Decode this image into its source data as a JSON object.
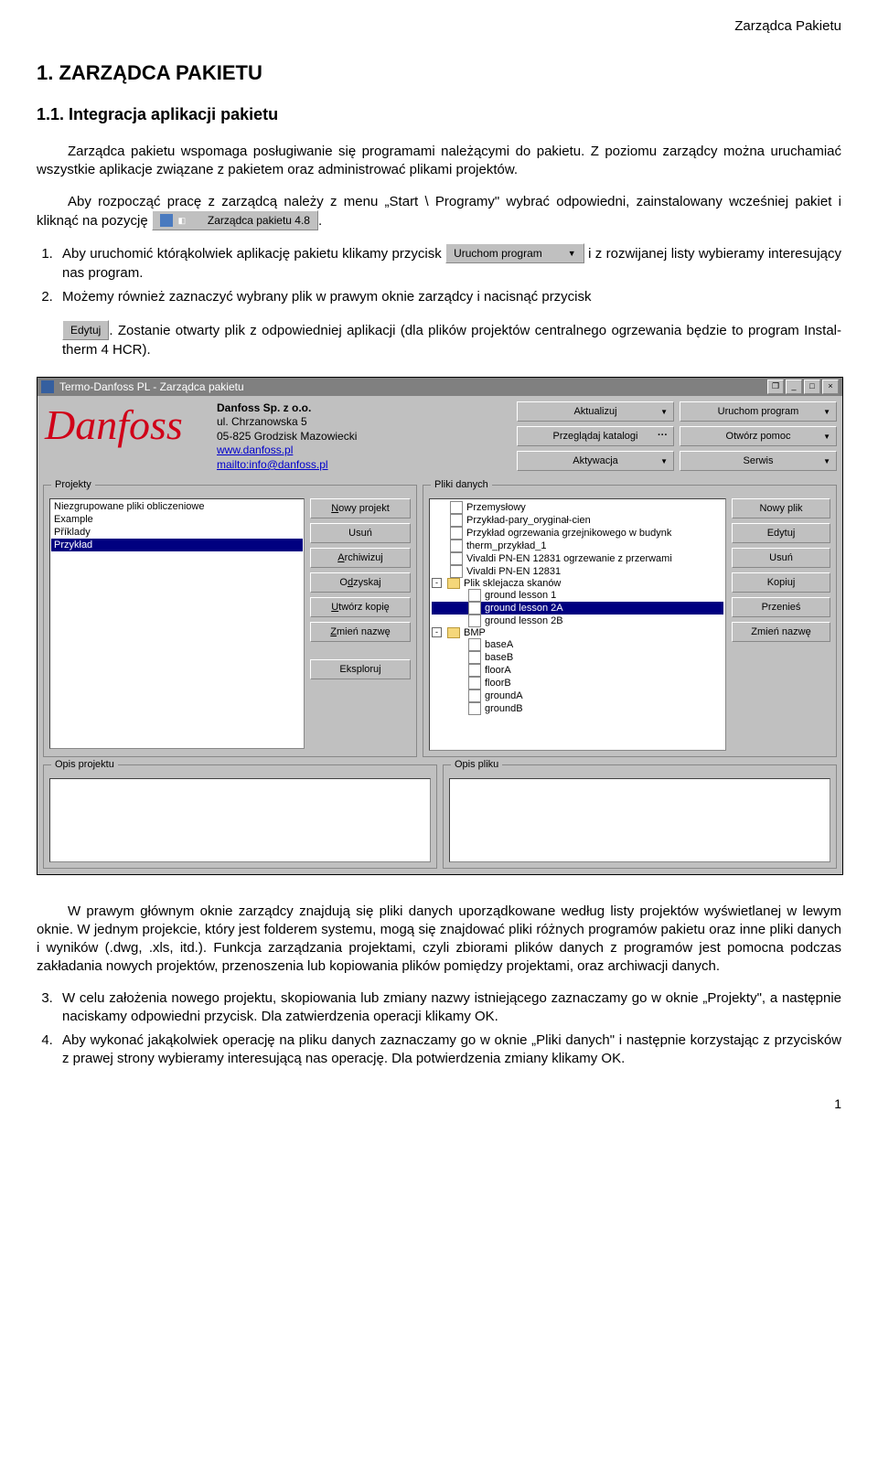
{
  "header_right": "Zarządca Pakietu",
  "h1": "1.  ZARZĄDCA PAKIETU",
  "h2": "1.1.   Integracja aplikacji pakietu",
  "p1": "Zarządca pakietu wspomaga posługiwanie się programami należącymi do pakietu. Z poziomu zarządcy można uruchamiać wszystkie aplikacje związane z pakietem oraz administrować plikami projektów.",
  "p2a": "Aby rozpocząć pracę z zarządcą należy z menu „Start \\ Programy\" wybrać odpowiedni, zainstalowany wcześniej pakiet i kliknąć na pozycję ",
  "menuitem_text": "Zarządca pakietu 4.8",
  "p2b": ".",
  "li1a": "Aby uruchomić którąkolwiek aplikację pakietu klikamy przycisk ",
  "btn_uruchom": "Uruchom program",
  "li1b": " i z rozwijanej listy wybieramy interesujący nas program.",
  "li2a": "Możemy również zaznaczyć wybrany plik w prawym oknie zarządcy i nacisnąć przycisk ",
  "btn_edytuj": "Edytuj",
  "li2b": ". Zostanie otwarty plik z odpowiedniej aplikacji (dla plików projektów centralnego ogrzewania będzie to program Instal-therm 4 HCR).",
  "app": {
    "title": "Termo-Danfoss PL - Zarządca pakietu",
    "company": "Danfoss Sp. z o.o.",
    "addr1": "ul. Chrzanowska 5",
    "addr2": "05-825 Grodzisk Mazowiecki",
    "url": "www.danfoss.pl",
    "mail": "mailto:info@danfoss.pl",
    "buttons": {
      "aktualizuj": "Aktualizuj",
      "przegladaj": "Przeglądaj katalogi",
      "aktywacja": "Aktywacja",
      "uruchom": "Uruchom program",
      "pomoc": "Otwórz pomoc",
      "serwis": "Serwis"
    },
    "group_proj": "Projekty",
    "group_files": "Pliki danych",
    "group_descp": "Opis projektu",
    "group_descf": "Opis pliku",
    "proj_list": [
      "Niezgrupowane pliki obliczeniowe",
      "Example",
      "Příklady",
      "Przykład"
    ],
    "proj_sel": 3,
    "proj_buttons": {
      "nowy": "Nowy projekt",
      "usun": "Usuń",
      "arch": "Archiwizuj",
      "odz": "Odzyskaj",
      "kopia": "Utwórz kopię",
      "nazwa": "Zmień nazwę",
      "ekspl": "Eksploruj"
    },
    "files": [
      {
        "type": "file",
        "label": "Przemysłowy"
      },
      {
        "type": "file",
        "label": "Przykład-pary_oryginał-cien"
      },
      {
        "type": "file",
        "label": "Przykład ogrzewania grzejnikowego w budynk"
      },
      {
        "type": "file",
        "label": "therm_przykład_1"
      },
      {
        "type": "file",
        "label": "Vivaldi PN-EN 12831 ogrzewanie z przerwami"
      },
      {
        "type": "file",
        "label": "Vivaldi PN-EN 12831"
      },
      {
        "type": "folder",
        "label": "Plik sklejacza skanów",
        "expand": "-"
      },
      {
        "type": "file",
        "label": "ground lesson 1",
        "ind": 1
      },
      {
        "type": "file",
        "label": "ground lesson 2A",
        "ind": 1,
        "sel": true
      },
      {
        "type": "file",
        "label": "ground lesson 2B",
        "ind": 1
      },
      {
        "type": "folder",
        "label": "BMP",
        "expand": "-",
        "ind": 0
      },
      {
        "type": "file",
        "label": "baseA",
        "ind": 1
      },
      {
        "type": "file",
        "label": "baseB",
        "ind": 1
      },
      {
        "type": "file",
        "label": "floorA",
        "ind": 1
      },
      {
        "type": "file",
        "label": "floorB",
        "ind": 1
      },
      {
        "type": "file",
        "label": "groundA",
        "ind": 1
      },
      {
        "type": "file",
        "label": "groundB",
        "ind": 1
      }
    ],
    "file_buttons": {
      "nowy": "Nowy plik",
      "edytuj": "Edytuj",
      "usun": "Usuń",
      "kopiuj": "Kopiuj",
      "przenies": "Przenieś",
      "nazwa": "Zmień nazwę"
    }
  },
  "p3": "W prawym głównym oknie zarządcy znajdują się pliki danych uporządkowane według listy projektów wyświetlanej w lewym oknie. W jednym projekcie, który jest folderem systemu, mogą się znajdować pliki różnych programów pakietu oraz inne pliki danych i wyników (.dwg, .xls, itd.). Funkcja zarządzania projektami, czyli zbiorami plików danych z programów jest pomocna podczas zakładania nowych projektów, przenoszenia lub kopiowania plików pomiędzy projektami, oraz archiwacji danych.",
  "li3": "W celu założenia nowego projektu, skopiowania lub zmiany nazwy istniejącego zaznaczamy go w oknie „Projekty\", a następnie naciskamy odpowiedni przycisk. Dla zatwierdzenia operacji klikamy OK.",
  "li4": "Aby wykonać jakąkolwiek operację na pliku danych zaznaczamy go w oknie „Pliki danych\" i następnie korzystając z przycisków z prawej strony wybieramy interesującą nas operację. Dla potwierdzenia zmiany klikamy OK.",
  "page_num": "1"
}
